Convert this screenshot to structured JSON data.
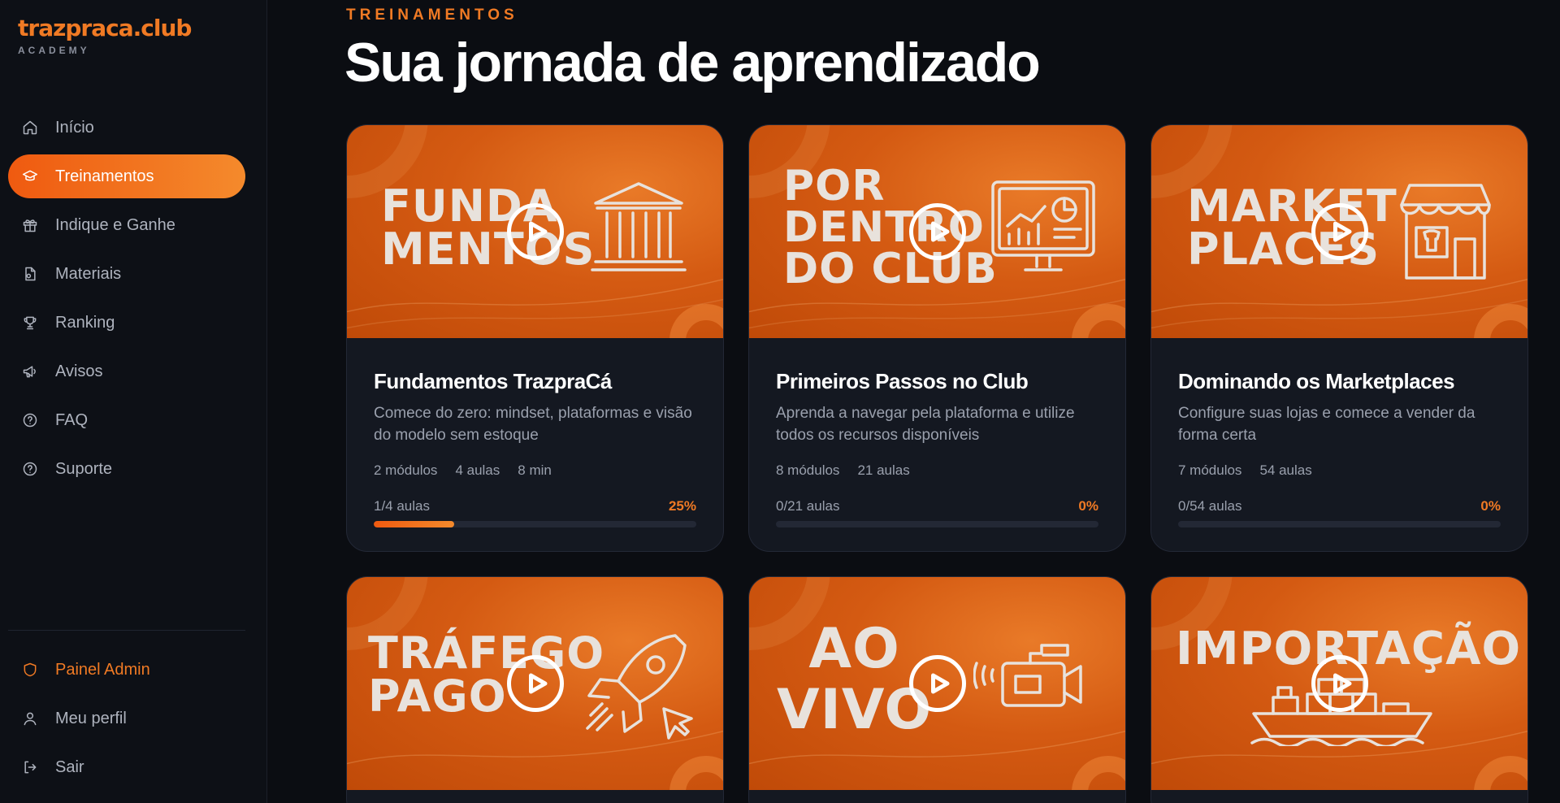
{
  "brand": {
    "logo": "trazpraca.club",
    "tagline": "ACADEMY"
  },
  "nav": {
    "items": [
      {
        "label": "Início",
        "icon": "home-icon",
        "active": false
      },
      {
        "label": "Treinamentos",
        "icon": "graduation-cap-icon",
        "active": true
      },
      {
        "label": "Indique e Ganhe",
        "icon": "gift-icon",
        "active": false
      },
      {
        "label": "Materiais",
        "icon": "file-icon",
        "active": false
      },
      {
        "label": "Ranking",
        "icon": "trophy-icon",
        "active": false
      },
      {
        "label": "Avisos",
        "icon": "megaphone-icon",
        "active": false
      },
      {
        "label": "FAQ",
        "icon": "help-circle-icon",
        "active": false
      },
      {
        "label": "Suporte",
        "icon": "help-circle-icon",
        "active": false
      }
    ],
    "bottom": [
      {
        "label": "Painel Admin",
        "icon": "shield-icon"
      },
      {
        "label": "Meu perfil",
        "icon": "user-icon"
      },
      {
        "label": "Sair",
        "icon": "logout-icon"
      }
    ]
  },
  "header": {
    "eyebrow": "TREINAMENTOS",
    "title": "Sua jornada de aprendizado"
  },
  "courses": [
    {
      "thumb_text": [
        "FUNDA",
        "MENTOS"
      ],
      "title": "Fundamentos TrazpraCá",
      "description": "Comece do zero: mindset, plataformas e visão do modelo sem estoque",
      "modules": "2 módulos",
      "lessons": "4 aulas",
      "duration": "8 min",
      "progress_label": "1/4 aulas",
      "progress_pct": "25%",
      "progress": 0.25
    },
    {
      "thumb_text": [
        "POR",
        "DENTRO",
        "DO CLUB"
      ],
      "title": "Primeiros Passos no Club",
      "description": "Aprenda a navegar pela plataforma e utilize todos os recursos disponíveis",
      "modules": "8 módulos",
      "lessons": "21 aulas",
      "progress_label": "0/21 aulas",
      "progress_pct": "0%",
      "progress": 0
    },
    {
      "thumb_text": [
        "MARKET",
        "PLACES"
      ],
      "title": "Dominando os Marketplaces",
      "description": "Configure suas lojas e comece a vender da forma certa",
      "modules": "7 módulos",
      "lessons": "54 aulas",
      "progress_label": "0/54 aulas",
      "progress_pct": "0%",
      "progress": 0
    },
    {
      "thumb_text": [
        "TRÁFEGO",
        "PAGO"
      ]
    },
    {
      "thumb_text": [
        "AO",
        "VIVO"
      ]
    },
    {
      "thumb_text": [
        "IMPORTAÇÃO"
      ]
    }
  ],
  "colors": {
    "accent": "#f07a24",
    "background": "#0b0d12",
    "sidebar": "#0d1016",
    "card": "#141821"
  }
}
